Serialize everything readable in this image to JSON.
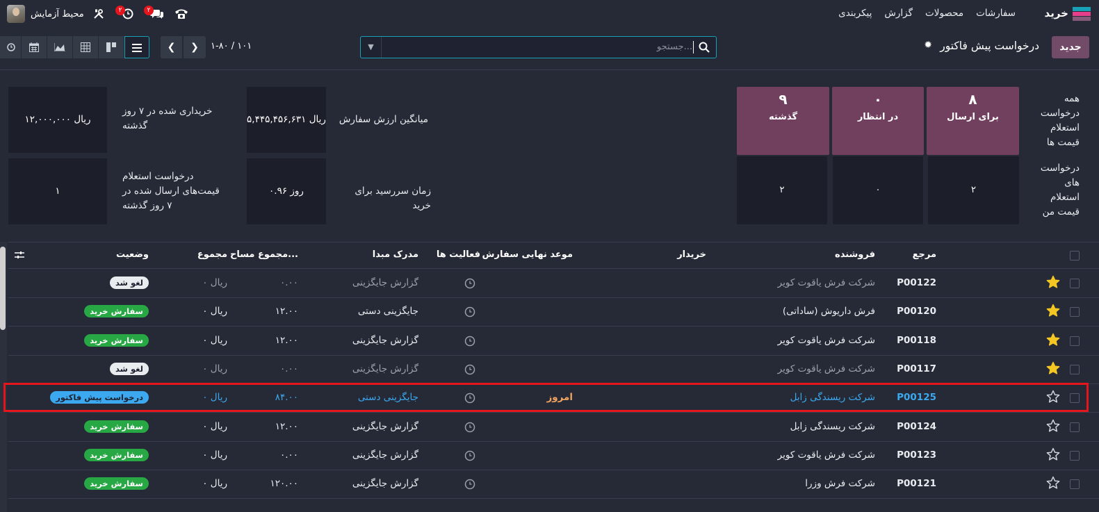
{
  "navbar": {
    "app_name": "خرید",
    "menu": [
      "سفارشات",
      "محصولات",
      "گزارش",
      "پیکربندی"
    ],
    "user_name": "محیط آزمایش",
    "activity_badge": "۲",
    "messages_badge": "۲"
  },
  "control": {
    "new_label": "جدید",
    "title": "درخواست پیش فاکتور",
    "search_placeholder": "جستجو...",
    "pager": "۱-۸۰ / ۱۰۱"
  },
  "dashboard": {
    "row1_label": "همه درخواست استعلام قیمت ها",
    "row2_label": "درخواست های استعلام قیمت من",
    "tiles": [
      {
        "value": "۸",
        "label": "برای ارسال",
        "mine": "۲"
      },
      {
        "value": "۰",
        "label": "در انتظار",
        "mine": "۰"
      },
      {
        "value": "۹",
        "label": "گذشته",
        "mine": "۲"
      }
    ],
    "stats": {
      "avg_order_label": "میانگین ارزش سفارش",
      "avg_order_value": "۵,۴۴۵,۴۵۶,۶۳۱ ریال",
      "lead_time_label": "زمان سررسید برای خرید",
      "lead_time_value": "۰.۹۶ روز",
      "purchased_label": "خریداری شده در ۷ روز گذشته",
      "purchased_value": "۱۲,۰۰۰,۰۰۰ ریال",
      "sent_label": "درخواست استعلام قیمت‌های ارسال شده در ۷ روز گذشته",
      "sent_value": "۱"
    }
  },
  "list": {
    "columns": {
      "ref": "مرجع",
      "vendor": "فروشنده",
      "buyer": "خریدار",
      "deadline": "موعد نهایی سفارش",
      "activities": "فعالیت ها",
      "source": "مدرک مبدا",
      "area_total": "مجموع مساح...",
      "total": "مجموع",
      "status": "وضعیت"
    },
    "rows": [
      {
        "ref": "P00122",
        "vendor": "شرکت فرش یاقوت کویر",
        "deadline": "",
        "source": "گزارش جایگزینی",
        "area": "۰.۰۰",
        "total": "ریال ۰",
        "status": "لغو شد",
        "starred": true
      },
      {
        "ref": "P00120",
        "vendor": "فرش داریوش (ساداتی)",
        "deadline": "",
        "source": "جایگزینی دستی",
        "area": "۱۲.۰۰",
        "total": "ریال ۰",
        "status": "سفارش خرید",
        "starred": true
      },
      {
        "ref": "P00118",
        "vendor": "شرکت فرش یاقوت کویر",
        "deadline": "",
        "source": "گزارش جایگزینی",
        "area": "۱۲.۰۰",
        "total": "ریال ۰",
        "status": "سفارش خرید",
        "starred": true
      },
      {
        "ref": "P00117",
        "vendor": "شرکت فرش یاقوت کویر",
        "deadline": "",
        "source": "گزارش جایگزینی",
        "area": "۰.۰۰",
        "total": "ریال ۰",
        "status": "لغو شد",
        "starred": true
      },
      {
        "ref": "P00125",
        "vendor": "شرکت ریسندگی زابل",
        "deadline": "امروز",
        "source": "جایگزینی دستی",
        "area": "۸۴.۰۰",
        "total": "ریال ۰",
        "status": "درخواست پیش فاکتور",
        "starred": false
      },
      {
        "ref": "P00124",
        "vendor": "شرکت ریسندگی زابل",
        "deadline": "",
        "source": "گزارش جایگزینی",
        "area": "۱۲.۰۰",
        "total": "ریال ۰",
        "status": "سفارش خرید",
        "starred": false
      },
      {
        "ref": "P00123",
        "vendor": "شرکت فرش یاقوت کویر",
        "deadline": "",
        "source": "گزارش جایگزینی",
        "area": "۰.۰۰",
        "total": "ریال ۰",
        "status": "سفارش خرید",
        "starred": false
      },
      {
        "ref": "P00121",
        "vendor": "شرکت فرش وزرا",
        "deadline": "",
        "source": "گزارش جایگزینی",
        "area": "۱۲۰.۰۰",
        "total": "ریال ۰",
        "status": "سفارش خرید",
        "starred": false
      }
    ]
  }
}
